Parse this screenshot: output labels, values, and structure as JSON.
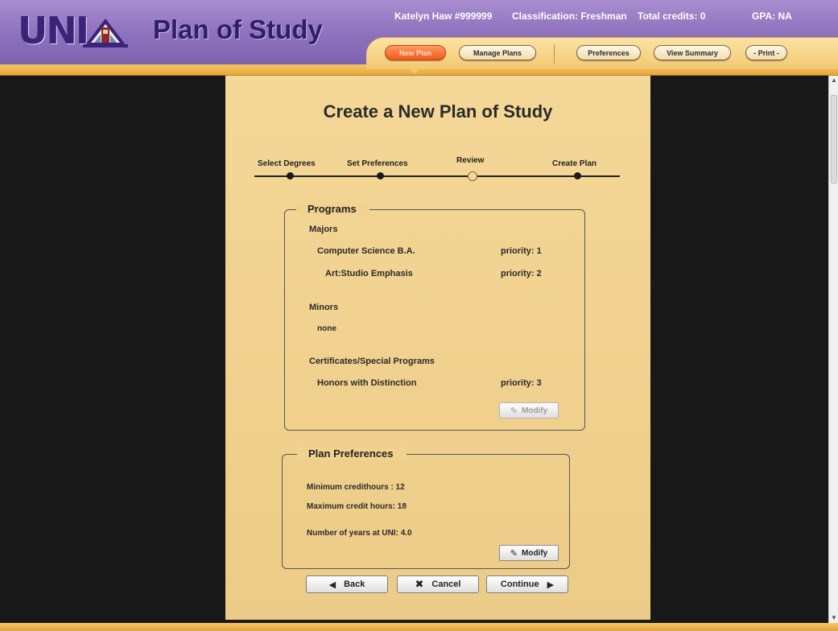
{
  "header": {
    "logo_text": "UNI",
    "app_title": "Plan of Study",
    "user_name": "Katelyn Haw #999999",
    "classification": "Classification: Freshman",
    "total_credits": "Total credits: 0",
    "gpa": "GPA: NA"
  },
  "tabs": [
    {
      "label": "New Plan",
      "active": true
    },
    {
      "label": "Manage Plans",
      "active": false
    },
    {
      "label": "Preferences",
      "active": false
    },
    {
      "label": "View Summary",
      "active": false
    },
    {
      "label": "- Print -",
      "active": false
    }
  ],
  "page": {
    "title": "Create a New Plan of Study"
  },
  "steps": [
    {
      "label": "Select Degrees"
    },
    {
      "label": "Set Preferences"
    },
    {
      "label": "Review",
      "current": true
    },
    {
      "label": "Create Plan"
    }
  ],
  "programs": {
    "legend": "Programs",
    "majors_heading": "Majors",
    "majors": [
      {
        "name": "Computer Science B.A.",
        "priority": "priority: 1"
      },
      {
        "name": "Art:Studio Emphasis",
        "priority": "priority: 2"
      }
    ],
    "minors_heading": "Minors",
    "minors_value": "none",
    "certificates_heading": "Certificates/Special Programs",
    "certificates": [
      {
        "name": "Honors with Distinction",
        "priority": "priority: 3"
      }
    ],
    "modify_label": "Modify"
  },
  "preferences": {
    "legend": "Plan Preferences",
    "min_hours": "Minimum credithours : 12",
    "max_hours": "Maximum credit hours: 18",
    "years": "Number of years at UNI: 4.0",
    "modify_label": "Modify"
  },
  "nav": {
    "back_label": "Back",
    "cancel_label": "Cancel",
    "continue_label": "Continue"
  },
  "colors": {
    "header_purple": "#8f73be",
    "panel_tan": "#f0d08d",
    "active_tab": "#f05a1a",
    "background_dark": "#181818"
  }
}
